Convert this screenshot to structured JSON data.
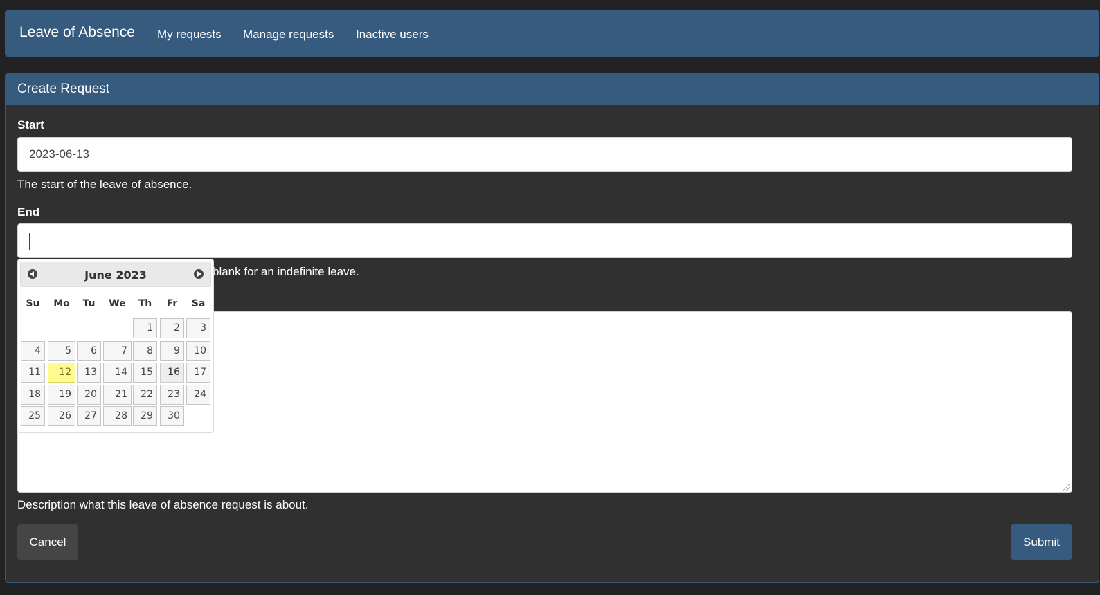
{
  "navbar": {
    "brand": "Leave of Absence",
    "links": [
      "My requests",
      "Manage requests",
      "Inactive users"
    ]
  },
  "panel": {
    "title": "Create Request"
  },
  "form": {
    "start_label": "Start",
    "start_value": "2023-06-13",
    "start_help": "The start of the leave of absence.",
    "end_label": "End",
    "end_value": "",
    "end_help_visible": "blank for an indefinite leave.",
    "description_help": "Description what this leave of absence request is about.",
    "cancel_label": "Cancel",
    "submit_label": "Submit"
  },
  "datepicker": {
    "title": "June 2023",
    "weekdays": [
      "Su",
      "Mo",
      "Tu",
      "We",
      "Th",
      "Fr",
      "Sa"
    ],
    "first_weekday_index": 4,
    "days_in_month": 30,
    "today": 12,
    "hover": 16
  },
  "colors": {
    "primary": "#375a7f",
    "background": "#222223",
    "panel": "#303030",
    "today_highlight": "#fffa90"
  }
}
